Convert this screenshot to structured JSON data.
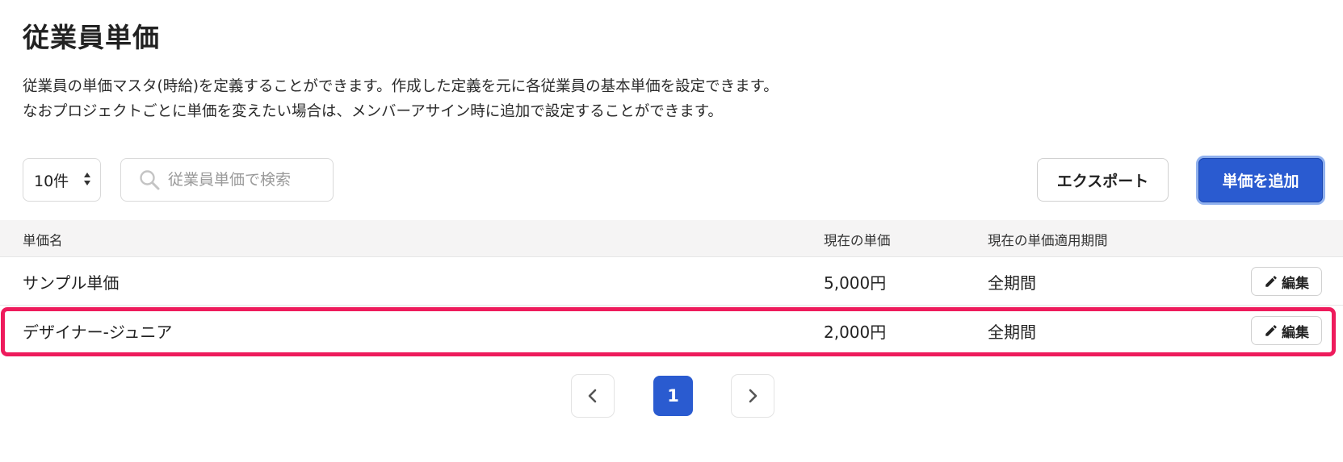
{
  "page": {
    "title": "従業員単価",
    "description_line1": "従業員の単価マスタ(時給)を定義することができます。作成した定義を元に各従業員の基本単価を設定できます。",
    "description_line2": "なおプロジェクトごとに単価を変えたい場合は、メンバーアサイン時に追加で設定することができます。"
  },
  "toolbar": {
    "per_page": "10件",
    "search_placeholder": "従業員単価で検索",
    "search_value": "",
    "export_label": "エクスポート",
    "add_label": "単価を追加"
  },
  "table": {
    "headers": {
      "name": "単価名",
      "price": "現在の単価",
      "period": "現在の単価適用期間"
    },
    "rows": [
      {
        "name": "サンプル単価",
        "price": "5,000円",
        "period": "全期間",
        "edit_label": "編集"
      },
      {
        "name": "デザイナー-ジュニア",
        "price": "2,000円",
        "period": "全期間",
        "edit_label": "編集"
      }
    ]
  },
  "pagination": {
    "current": "1"
  },
  "icons": {
    "search": "search-icon",
    "pencil": "pencil-icon",
    "prev": "chevron-left-icon",
    "next": "chevron-right-icon",
    "updown": "updown-arrows-icon"
  },
  "colors": {
    "primary": "#2a5bd0",
    "highlight": "#ee1b5c",
    "header_bg": "#f5f4f4"
  }
}
